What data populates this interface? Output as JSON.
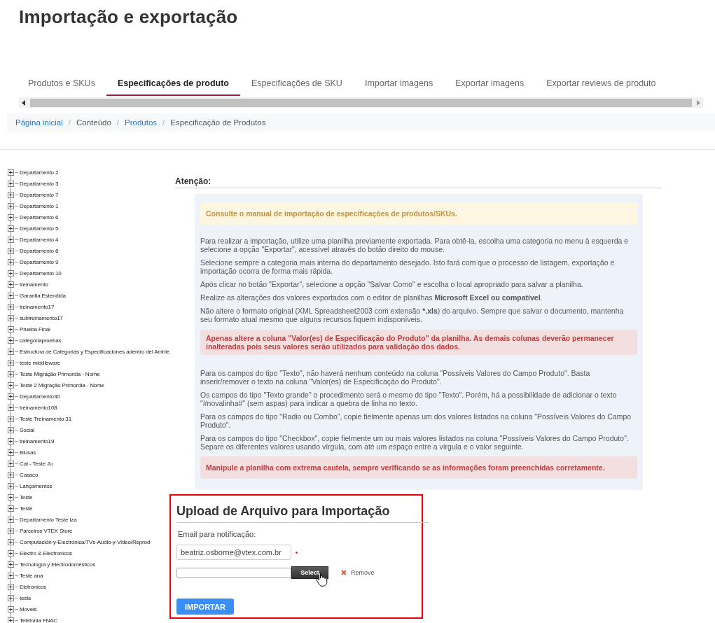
{
  "page_title": "Importação e exportação",
  "tabs": [
    {
      "label": "Produtos e SKUs",
      "selected": false
    },
    {
      "label": "Especificações de produto",
      "selected": true
    },
    {
      "label": "Especificações de SKU",
      "selected": false
    },
    {
      "label": "Importar imagens",
      "selected": false
    },
    {
      "label": "Exportar imagens",
      "selected": false
    },
    {
      "label": "Exportar reviews de produto",
      "selected": false
    }
  ],
  "breadcrumb_separator": "/",
  "breadcrumb": [
    {
      "label": "Página inicial",
      "kind": "link"
    },
    {
      "label": "Conteúdo",
      "kind": "text"
    },
    {
      "label": "Produtos",
      "kind": "link"
    },
    {
      "label": "Especificação de Produtos",
      "kind": "text"
    }
  ],
  "category_tree": [
    {
      "label": "Departamento 2",
      "expanded": false
    },
    {
      "label": "Departamento 3",
      "expanded": false
    },
    {
      "label": "Departamento 7",
      "expanded": false
    },
    {
      "label": "Departamento 1",
      "expanded": false
    },
    {
      "label": "Departamento 6",
      "expanded": false
    },
    {
      "label": "Departamento 5",
      "expanded": false
    },
    {
      "label": "Departamento 4",
      "expanded": false
    },
    {
      "label": "Departamento 8",
      "expanded": false
    },
    {
      "label": "Departamento 9",
      "expanded": false
    },
    {
      "label": "Departamento 10",
      "expanded": false
    },
    {
      "label": "treinamento",
      "expanded": false
    },
    {
      "label": "Garantia Estendida",
      "expanded": false
    },
    {
      "label": "treinamento17",
      "expanded": false
    },
    {
      "label": "subtreinamento17",
      "expanded": false
    },
    {
      "label": "Prueba Final",
      "expanded": false
    },
    {
      "label": "categoriapruebas",
      "expanded": false
    },
    {
      "label": "Estructura de Categorias y Especificaciones adentro del Ambie",
      "expanded": false
    },
    {
      "label": "teste middleware",
      "expanded": false
    },
    {
      "label": "Teste Migração Primordia - Nome",
      "expanded": false
    },
    {
      "label": "Teste 2 Migração Primordia - Nome",
      "expanded": false
    },
    {
      "label": "Departamento30",
      "expanded": false
    },
    {
      "label": "treinamento108",
      "expanded": false
    },
    {
      "label": "Teste Treinamento 31",
      "expanded": false
    },
    {
      "label": "Social",
      "expanded": false
    },
    {
      "label": "treinamento19",
      "expanded": false
    },
    {
      "label": "Blusas",
      "expanded": false
    },
    {
      "label": "Cat - Teste Ju",
      "expanded": false
    },
    {
      "label": "Casaco",
      "expanded": false
    },
    {
      "label": "Lançamentos",
      "expanded": false
    },
    {
      "label": "Teste",
      "expanded": false
    },
    {
      "label": "Teste",
      "expanded": false
    },
    {
      "label": "Departamento Teste Iza",
      "expanded": false
    },
    {
      "label": "Parceiros VTEX Store",
      "expanded": false
    },
    {
      "label": "Computación-y-Electrónica/TVs-Audio-y-Video/Reprod",
      "expanded": false
    },
    {
      "label": "Electro & Electronicos",
      "expanded": false
    },
    {
      "label": "Tecnología y Electrodomésticos",
      "expanded": false
    },
    {
      "label": "Teste ana",
      "expanded": false
    },
    {
      "label": "Eletronicos",
      "expanded": false
    },
    {
      "label": "teste",
      "expanded": false
    },
    {
      "label": "Moveis",
      "expanded": false
    },
    {
      "label": "Telefonia FNAC",
      "expanded": false
    }
  ],
  "attention": {
    "heading": "Atenção:",
    "paragraphs": [
      {
        "kind": "warning",
        "text": "Consulte o manual de importação de especificações de produtos/SKUs."
      },
      {
        "kind": "text",
        "text": "Para realizar a importação, utilize uma planilha previamente exportada. Para obtê-la, escolha uma categoria no menu à esquerda e selecione a opção \"Exportar\", acessível através do botão direito do mouse."
      },
      {
        "kind": "text",
        "text": "Selecione sempre a categoria mais interna do departamento desejado. Isto fará com que o processo de listagem, exportação e importação ocorra de forma mais rápida."
      },
      {
        "kind": "text",
        "text": "Após clicar no botão \"Exportar\", selecione a opção \"Salvar Como\" e escolha o local apropriado para salvar a planilha."
      },
      {
        "kind": "text",
        "text": "Realize as alterações dos valores exportados com o editor de planilhas **Microsoft Excel ou compatível**."
      },
      {
        "kind": "text",
        "text": "Não altere o formato original (XML Spreadsheet2003 com extensão ***.xls**) do arquivo. Sempre que salvar o documento, mantenha seu formato atual mesmo que alguns recursos fiquem indisponíveis."
      },
      {
        "kind": "danger",
        "text": "Apenas altere a coluna \"Valor(es) de Especificação do Produto\" da planilha. As demais colunas deverão permanecer inalteradas pois seus valores serão utilizados para validação dos dados."
      },
      {
        "kind": "text",
        "text": "Para os campos do tipo \"Texto\", não haverá nenhum conteúdo na coluna \"Possíveis Valores do Campo Produto\". Basta inserir/remover o texto na coluna \"Valor(es) de Especificação do Produto\"."
      },
      {
        "kind": "text",
        "text": "Os campos do tipo \"Texto grande\" o procedimento será o mesmo do tipo \"Texto\". Porém, há a possibilidade de adicionar o texto \"#novalinha#\" (sem aspas) para indicar a quebra de linha no texto."
      },
      {
        "kind": "text",
        "text": "Para os campos do tipo \"Radio ou Combo\", copie fielmente apenas um dos valores listados na coluna \"Possíveis Valores do Campo Produto\"."
      },
      {
        "kind": "text",
        "text": "Para os campos do tipo \"Checkbox\", copie fielmente um ou mais valores listados na coluna \"Possíveis Valores do Campo Produto\". Separe os diferentes valores usando vírgula, com até um espaço entre a vírgula e o valor seguinte."
      },
      {
        "kind": "danger",
        "text": "Manipule a planilha com extrema cautela, sempre verificando se as informações foram preenchidas corretamente."
      }
    ]
  },
  "upload": {
    "heading": "Upload de Arquivo para Importação",
    "email_label": "Email para notificação:",
    "email_value": "beatriz.osborne@vtex.com.br",
    "email_required": true,
    "select_button": "Select",
    "remove_button": "Remove",
    "submit_button": "IMPORTAR"
  }
}
